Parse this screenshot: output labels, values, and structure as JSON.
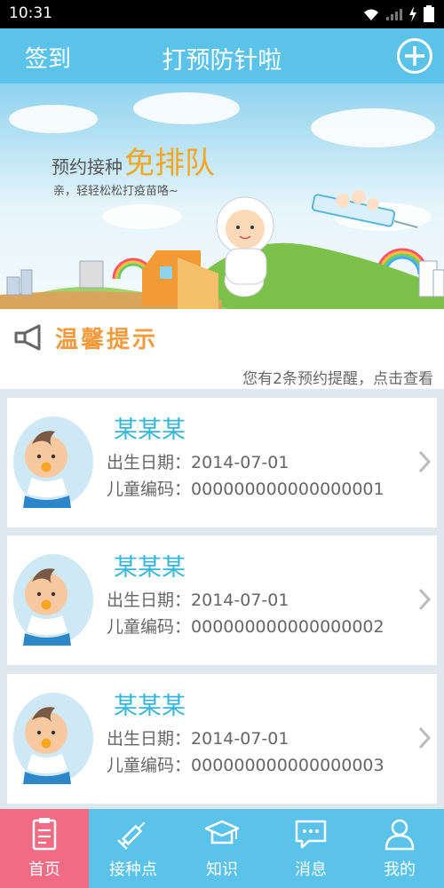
{
  "status_bar": {
    "time": "10:31"
  },
  "nav": {
    "left_label": "签到",
    "title": "打预防针啦"
  },
  "banner": {
    "headline_small": "预约接种",
    "headline_big": "免排队",
    "subline": "亲，轻轻松松打疫苗咯~"
  },
  "tips": {
    "title": "温馨提示",
    "marquee": "您有2条预约提醒，点击查看"
  },
  "children": [
    {
      "name": "某某某",
      "birth_label": "出生日期：",
      "birth": "2014-07-01",
      "code_label": "儿童编码：",
      "code": "000000000000000001"
    },
    {
      "name": "某某某",
      "birth_label": "出生日期：",
      "birth": "2014-07-01",
      "code_label": "儿童编码：",
      "code": "000000000000000002"
    },
    {
      "name": "某某某",
      "birth_label": "出生日期：",
      "birth": "2014-07-01",
      "code_label": "儿童编码：",
      "code": "000000000000000003"
    }
  ],
  "tabs": [
    {
      "label": "首页",
      "icon": "clipboard-icon",
      "active": true
    },
    {
      "label": "接种点",
      "icon": "syringe-icon",
      "active": false
    },
    {
      "label": "知识",
      "icon": "graduation-cap-icon",
      "active": false
    },
    {
      "label": "消息",
      "icon": "chat-bubble-icon",
      "active": false
    },
    {
      "label": "我的",
      "icon": "user-icon",
      "active": false
    }
  ],
  "colors": {
    "primary": "#5bc3ea",
    "active_tab": "#f06b83",
    "tips_orange": "#f39a3c",
    "name_blue": "#36b6d8"
  }
}
